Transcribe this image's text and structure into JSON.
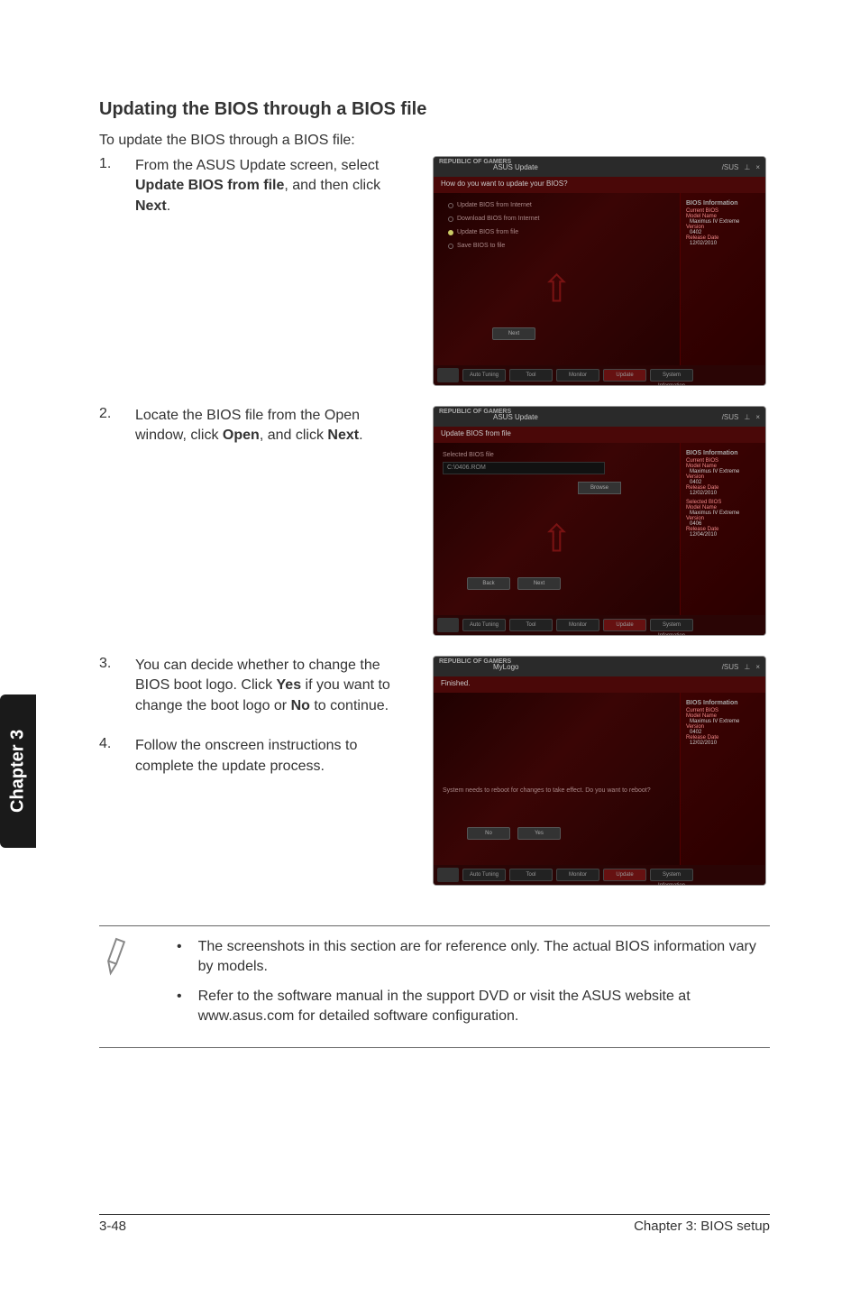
{
  "heading": "Updating the BIOS through a BIOS file",
  "intro": "To update the BIOS through a BIOS file:",
  "steps": {
    "s1_num": "1.",
    "s1_text_pre": "From the ASUS Update screen, select ",
    "s1_bold": "Update BIOS from file",
    "s1_text_mid": ", and then click ",
    "s1_bold2": "Next",
    "s1_text_end": ".",
    "s2_num": "2.",
    "s2_text_pre": "Locate the BIOS file from the Open window, click ",
    "s2_bold": "Open",
    "s2_text_mid": ", and click ",
    "s2_bold2": "Next",
    "s2_text_end": ".",
    "s3_num": "3.",
    "s3_text_pre": "You can decide whether to change the BIOS boot logo. Click ",
    "s3_bold": "Yes",
    "s3_text_mid": " if you want to change the boot logo or ",
    "s3_bold2": "No",
    "s3_text_end": " to continue.",
    "s4_num": "4.",
    "s4_text": "Follow the onscreen instructions to complete the update process."
  },
  "screenshots": {
    "logo_text": "REPUBLIC OF\nGAMERS",
    "asus_text": "/SUS",
    "sc1": {
      "title": "ASUS Update",
      "subheader": "How do you want to update your BIOS?",
      "options": {
        "o1": "Update BIOS from Internet",
        "o2": "Download BIOS from Internet",
        "o3": "Update BIOS from file",
        "o4": "Save BIOS to file"
      },
      "next_btn": "Next"
    },
    "sc2": {
      "title": "ASUS Update",
      "subheader": "Update BIOS from file",
      "selected_label": "Selected BIOS file",
      "path": "C:\\0406.ROM",
      "browse": "Browse",
      "back": "Back",
      "next": "Next"
    },
    "sc3": {
      "title": "MyLogo",
      "subheader": "Finished.",
      "msg": "System needs to reboot for changes to take effect. Do you want to reboot?",
      "no": "No",
      "yes": "Yes"
    },
    "sidebar": {
      "title": "BIOS Information",
      "current_title": "Current BIOS",
      "model_label": "Model Name",
      "model_value": "Maximus IV Extreme",
      "version_label": "Version",
      "version_value": "0402",
      "release_label": "Release Date",
      "release_value": "12/02/2010",
      "selected_title": "Selected BIOS",
      "sel_model_label": "Model Name",
      "sel_model_value": "Maximus IV Extreme",
      "sel_version_label": "Version",
      "sel_version_value": "0406",
      "sel_release_label": "Release Date",
      "sel_release_value": "12/04/2010"
    },
    "footer": {
      "auto": "Auto Tuning",
      "tool": "Tool",
      "monitor": "Monitor",
      "update": "Update",
      "sysinfo": "System Information"
    }
  },
  "notes": {
    "n1": "The screenshots in this section are for reference only. The actual BIOS information vary by models.",
    "n2": "Refer to the software manual in the support DVD or visit the ASUS website at www.asus.com for detailed software configuration."
  },
  "footer": {
    "page_num": "3-48",
    "chapter_label": "Chapter 3: BIOS setup"
  },
  "side_tab": "Chapter 3"
}
